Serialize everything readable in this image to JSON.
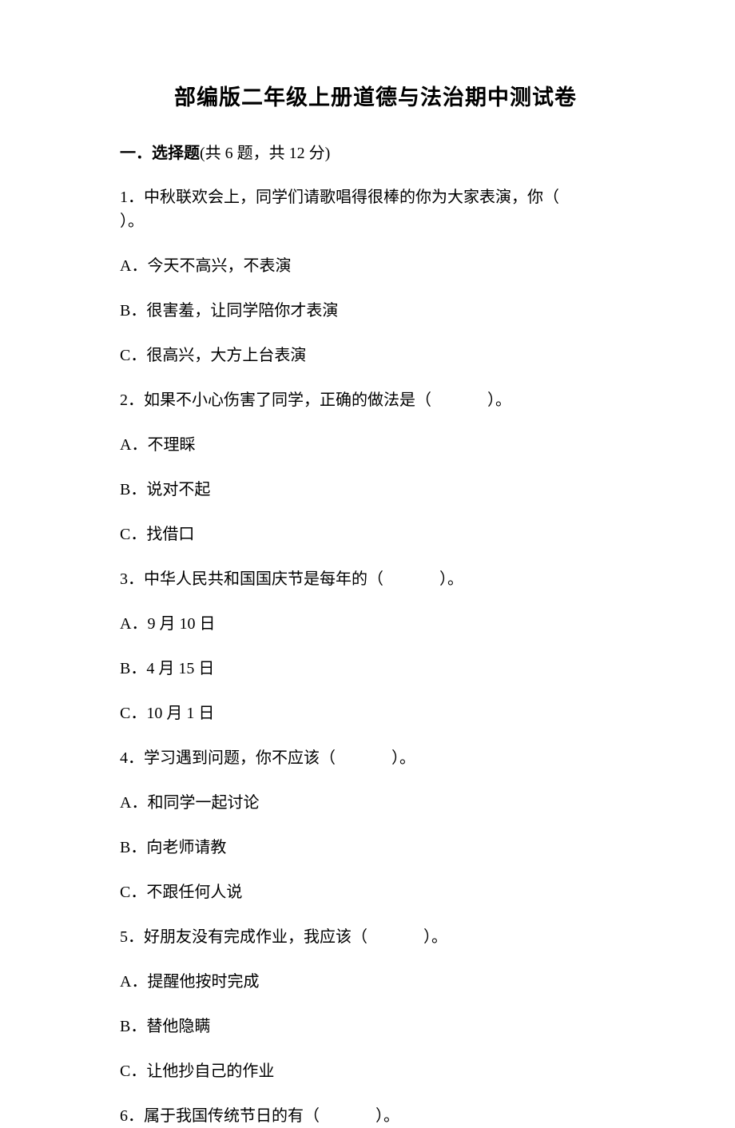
{
  "title": "部编版二年级上册道德与法治期中测试卷",
  "section": {
    "label": "一．选择题",
    "meta": "(共 6 题，共 12 分)"
  },
  "q1": {
    "stem_a": "1．中秋联欢会上，同学们请歌唱得很棒的你为大家表演，你（",
    "stem_b": "）。",
    "A": "A．今天不高兴，不表演",
    "B": "B．很害羞，让同学陪你才表演",
    "C": "C．很高兴，大方上台表演"
  },
  "q2": {
    "stem_a": "2．如果不小心伤害了同学，正确的做法是（",
    "stem_b": "）。",
    "A": "A．不理睬",
    "B": "B．说对不起",
    "C": "C．找借口"
  },
  "q3": {
    "stem_a": "3．中华人民共和国国庆节是每年的（",
    "stem_b": "）。",
    "A": "A．9 月 10 日",
    "B": "B．4 月 15 日",
    "C": "C．10 月 1 日"
  },
  "q4": {
    "stem_a": "4．学习遇到问题，你不应该（",
    "stem_b": "）。",
    "A": "A．和同学一起讨论",
    "B": "B．向老师请教",
    "C": "C．不跟任何人说"
  },
  "q5": {
    "stem_a": "5．好朋友没有完成作业，我应该（",
    "stem_b": "）。",
    "A": "A．提醒他按时完成",
    "B": "B．替他隐瞒",
    "C": "C．让他抄自己的作业"
  },
  "q6": {
    "stem_a": "6．属于我国传统节日的有（",
    "stem_b": "）。"
  }
}
